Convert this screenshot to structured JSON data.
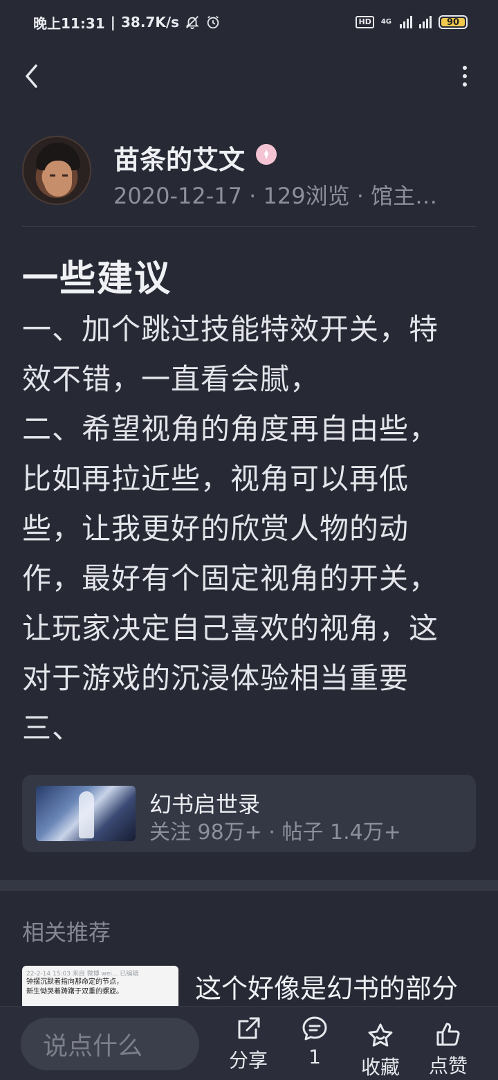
{
  "status_bar": {
    "time": "晚上11:31",
    "speed": "38.7K/s",
    "hd": "HD",
    "network": "4G",
    "battery": "90"
  },
  "author": {
    "name": "苗条的艾文",
    "meta": "2020-12-17 · 129浏览 · 馆主…"
  },
  "post": {
    "title": "一些建议",
    "body_lines": [
      "一、加个跳过技能特效开关，特",
      "效不错，一直看会腻，",
      "二、希望视角的角度再自由些，",
      "比如再拉近些，视角可以再低",
      "些，让我更好的欣赏人物的动",
      "作，最好有个固定视角的开关，",
      "让玩家决定自己喜欢的视角，这",
      "对于游戏的沉浸体验相当重要",
      "三、"
    ]
  },
  "forum": {
    "name": "幻书启世录",
    "stats": "关注 98万+ · 帖子 1.4万+"
  },
  "related": {
    "heading": "相关推荐",
    "item": {
      "title": "这个好像是幻书的部分",
      "thumb_meta": "22-2-14 15:03 来自 微博 wei... 已编辑",
      "thumb_line1": "钟摆沉默着指向那命定的节点，",
      "thumb_line2": "新生恸哭着踌躇于双重的螺旋。"
    }
  },
  "bottom_bar": {
    "comment_placeholder": "说点什么",
    "share_label": "分享",
    "comment_count": "1",
    "favorite_label": "收藏",
    "like_label": "点赞"
  }
}
